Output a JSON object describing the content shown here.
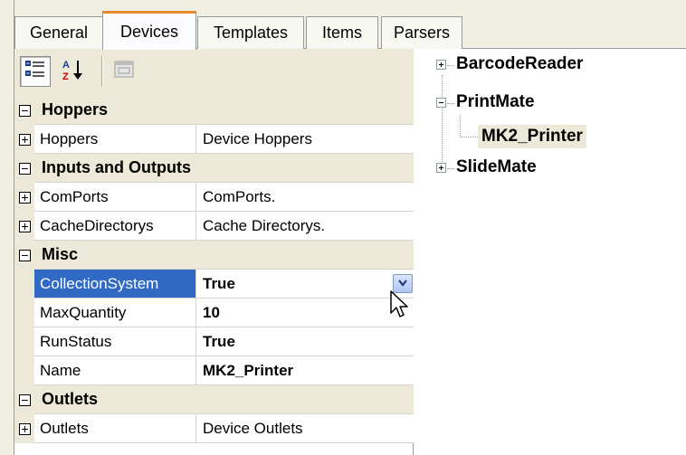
{
  "tabs": [
    {
      "label": "General"
    },
    {
      "label": "Devices",
      "active": true
    },
    {
      "label": "Templates"
    },
    {
      "label": "Items"
    },
    {
      "label": "Parsers"
    }
  ],
  "toolbar": {
    "buttons": [
      {
        "icon": "categorized-icon",
        "pressed": true
      },
      {
        "icon": "alphabetical-sort-icon",
        "pressed": false
      },
      {
        "icon": "property-pages-icon",
        "pressed": false,
        "disabled": true
      }
    ],
    "sort_glyph": "A Z"
  },
  "property_grid": {
    "categories": [
      {
        "label": "Hoppers",
        "expanded": true,
        "rows": [
          {
            "name": "Hoppers",
            "value": "Device Hoppers",
            "expandable": true,
            "bold": false
          }
        ]
      },
      {
        "label": "Inputs and Outputs",
        "expanded": true,
        "rows": [
          {
            "name": "ComPorts",
            "value": "ComPorts.",
            "expandable": true,
            "bold": false
          },
          {
            "name": "CacheDirectorys",
            "value": "Cache Directorys.",
            "expandable": true,
            "bold": false
          }
        ]
      },
      {
        "label": "Misc",
        "expanded": true,
        "rows": [
          {
            "name": "CollectionSystem",
            "value": "True",
            "expandable": false,
            "bold": true,
            "selected": true,
            "dropdown": true
          },
          {
            "name": "MaxQuantity",
            "value": "10",
            "expandable": false,
            "bold": true
          },
          {
            "name": "RunStatus",
            "value": "True",
            "expandable": false,
            "bold": true
          },
          {
            "name": "Name",
            "value": "MK2_Printer",
            "expandable": false,
            "bold": true
          }
        ]
      },
      {
        "label": "Outlets",
        "expanded": true,
        "rows": [
          {
            "name": "Outlets",
            "value": "Device Outlets",
            "expandable": true,
            "bold": false
          }
        ]
      }
    ]
  },
  "tree": {
    "nodes": [
      {
        "label": "BarcodeReader",
        "expanded": false,
        "level": 0
      },
      {
        "label": "PrintMate",
        "expanded": true,
        "level": 0
      },
      {
        "label": "MK2_Printer",
        "level": 1,
        "selected": true
      },
      {
        "label": "SlideMate",
        "expanded": false,
        "level": 0
      }
    ]
  },
  "colors": {
    "selection": "#316ac5",
    "active_tab_accent": "#e68b2c",
    "category_bg": "#ece9d8"
  }
}
